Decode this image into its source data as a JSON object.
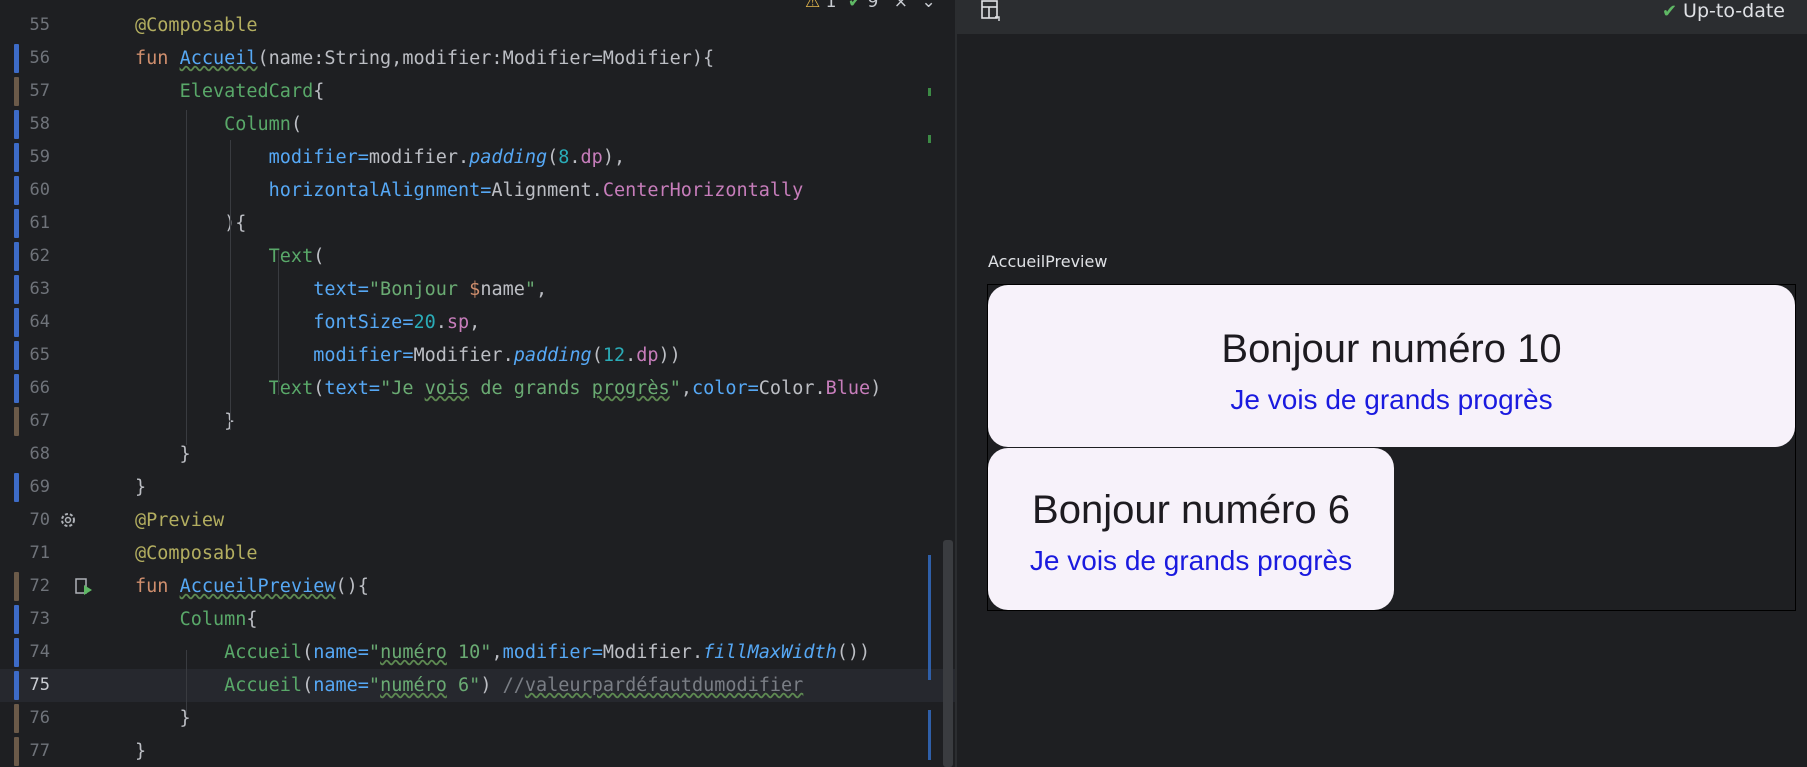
{
  "editor": {
    "top_badges": {
      "warnings": "1",
      "checks": "9"
    },
    "lines": [
      {
        "n": "55",
        "tokens": [
          [
            "ann",
            "@Composable"
          ]
        ]
      },
      {
        "n": "56",
        "tokens": [
          [
            "kw",
            "fun "
          ],
          [
            "fn und",
            "Accueil"
          ],
          [
            "",
            "(name:String,modifier:Modifier=Modifier){"
          ]
        ]
      },
      {
        "n": "57",
        "tokens": [
          [
            "",
            "    "
          ],
          [
            "call",
            "ElevatedCard"
          ],
          [
            "",
            "{"
          ]
        ]
      },
      {
        "n": "58",
        "tokens": [
          [
            "",
            "        "
          ],
          [
            "call",
            "Column"
          ],
          [
            "",
            "("
          ]
        ]
      },
      {
        "n": "59",
        "tokens": [
          [
            "",
            "            "
          ],
          [
            "par",
            "modifier="
          ],
          [
            "",
            "modifier."
          ],
          [
            "ext",
            "padding"
          ],
          [
            "",
            "("
          ],
          [
            "num",
            "8"
          ],
          [
            "",
            "."
          ],
          [
            "prop",
            "dp"
          ],
          [
            "",
            "),"
          ]
        ]
      },
      {
        "n": "60",
        "tokens": [
          [
            "",
            "            "
          ],
          [
            "par",
            "horizontalAlignment="
          ],
          [
            "",
            "Alignment."
          ],
          [
            "prop",
            "CenterHorizontally"
          ]
        ]
      },
      {
        "n": "61",
        "tokens": [
          [
            "",
            "        ){"
          ]
        ]
      },
      {
        "n": "62",
        "tokens": [
          [
            "",
            "            "
          ],
          [
            "call",
            "Text"
          ],
          [
            "",
            "("
          ]
        ]
      },
      {
        "n": "63",
        "tokens": [
          [
            "",
            "                "
          ],
          [
            "par",
            "text="
          ],
          [
            "str",
            "\"Bonjour "
          ],
          [
            "kw",
            "$"
          ],
          [
            "",
            "name"
          ],
          [
            "str",
            "\""
          ],
          [
            "",
            ","
          ]
        ]
      },
      {
        "n": "64",
        "tokens": [
          [
            "",
            "                "
          ],
          [
            "par",
            "fontSize="
          ],
          [
            "num",
            "20"
          ],
          [
            "",
            "."
          ],
          [
            "prop",
            "sp"
          ],
          [
            "",
            ","
          ]
        ]
      },
      {
        "n": "65",
        "tokens": [
          [
            "",
            "                "
          ],
          [
            "par",
            "modifier="
          ],
          [
            "",
            "Modifier."
          ],
          [
            "ext",
            "padding"
          ],
          [
            "",
            "("
          ],
          [
            "num",
            "12"
          ],
          [
            "",
            "."
          ],
          [
            "prop",
            "dp"
          ],
          [
            "",
            "))"
          ]
        ]
      },
      {
        "n": "66",
        "tokens": [
          [
            "",
            "            "
          ],
          [
            "call",
            "Text"
          ],
          [
            "",
            "("
          ],
          [
            "par",
            "text="
          ],
          [
            "str",
            "\"Je "
          ],
          [
            "str und",
            "vois"
          ],
          [
            "str",
            " de grands "
          ],
          [
            "str und",
            "progrès"
          ],
          [
            "str",
            "\""
          ],
          [
            "",
            ","
          ],
          [
            "par",
            "color="
          ],
          [
            "",
            "Color."
          ],
          [
            "prop",
            "Blue"
          ],
          [
            "",
            ")"
          ]
        ]
      },
      {
        "n": "67",
        "tokens": [
          [
            "",
            "        }"
          ]
        ]
      },
      {
        "n": "68",
        "tokens": [
          [
            "",
            "    }"
          ]
        ]
      },
      {
        "n": "69",
        "tokens": [
          [
            "",
            "}"
          ]
        ]
      },
      {
        "n": "70",
        "tokens": [
          [
            "ann",
            "@Preview"
          ]
        ]
      },
      {
        "n": "71",
        "tokens": [
          [
            "ann",
            "@Composable"
          ]
        ]
      },
      {
        "n": "72",
        "tokens": [
          [
            "kw",
            "fun "
          ],
          [
            "fn und",
            "AccueilPreview"
          ],
          [
            "",
            "(){"
          ]
        ]
      },
      {
        "n": "73",
        "tokens": [
          [
            "",
            "    "
          ],
          [
            "call",
            "Column"
          ],
          [
            "",
            "{"
          ]
        ]
      },
      {
        "n": "74",
        "tokens": [
          [
            "",
            "        "
          ],
          [
            "call",
            "Accueil"
          ],
          [
            "",
            "("
          ],
          [
            "par",
            "name="
          ],
          [
            "str",
            "\""
          ],
          [
            "str und",
            "numéro"
          ],
          [
            "str",
            " 10\""
          ],
          [
            "",
            ","
          ],
          [
            "par",
            "modifier="
          ],
          [
            "",
            "Modifier."
          ],
          [
            "ext",
            "fillMaxWidth"
          ],
          [
            "",
            "())"
          ]
        ]
      },
      {
        "n": "75",
        "tokens": [
          [
            "",
            "        "
          ],
          [
            "call",
            "Accueil"
          ],
          [
            "",
            "("
          ],
          [
            "par",
            "name="
          ],
          [
            "str",
            "\""
          ],
          [
            "str und",
            "numéro"
          ],
          [
            "str",
            " 6\""
          ],
          [
            "",
            ") "
          ],
          [
            "cmt",
            "//"
          ],
          [
            "cmt und",
            "valeurpardéfautdumodifier"
          ]
        ]
      },
      {
        "n": "76",
        "tokens": [
          [
            "",
            "    }"
          ]
        ]
      },
      {
        "n": "77",
        "tokens": [
          [
            "",
            "}"
          ]
        ]
      }
    ]
  },
  "preview": {
    "status": "Up-to-date",
    "label": "AccueilPreview",
    "cards": [
      {
        "title": "Bonjour numéro 10",
        "subtitle": "Je vois de grands progrès"
      },
      {
        "title": "Bonjour numéro 6",
        "subtitle": "Je vois de grands progrès"
      }
    ]
  },
  "icons": [
    "warning-icon",
    "check-icon",
    "close-icon",
    "chevron-down-icon",
    "gear-icon",
    "run-preview-icon",
    "layout-icon",
    "up-to-date-check-icon"
  ]
}
